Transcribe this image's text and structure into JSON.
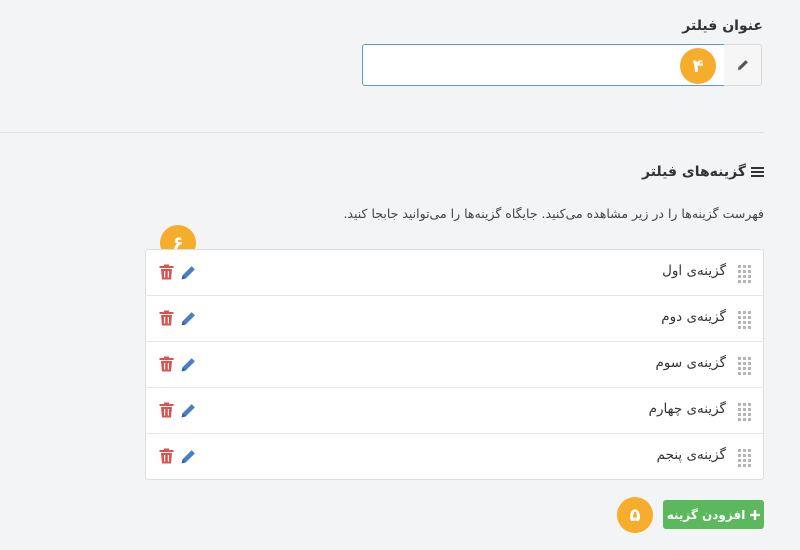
{
  "filter_title": {
    "label": "عنوان فیلتر",
    "input_value": "",
    "input_placeholder": ""
  },
  "options_section": {
    "title": "گزینه‌های فیلتر",
    "help_text": "فهرست گزینه‌ها را در زیر مشاهده می‌کنید. جایگاه گزینه‌ها را می‌توانید جابجا کنید.",
    "options": [
      {
        "label": "گزینه‌ی اول"
      },
      {
        "label": "گزینه‌ی دوم"
      },
      {
        "label": "گزینه‌ی سوم"
      },
      {
        "label": "گزینه‌ی چهارم"
      },
      {
        "label": "گزینه‌ی پنجم"
      }
    ],
    "add_button_label": "افزودن گزینه"
  },
  "badges": {
    "title_input": "۴",
    "add_button": "۵",
    "option_actions": "۶"
  },
  "colors": {
    "accent_blue": "#4a7fc1",
    "delete_red": "#d9534f",
    "add_green": "#5cb85c",
    "badge_orange": "#f6ad2b"
  }
}
